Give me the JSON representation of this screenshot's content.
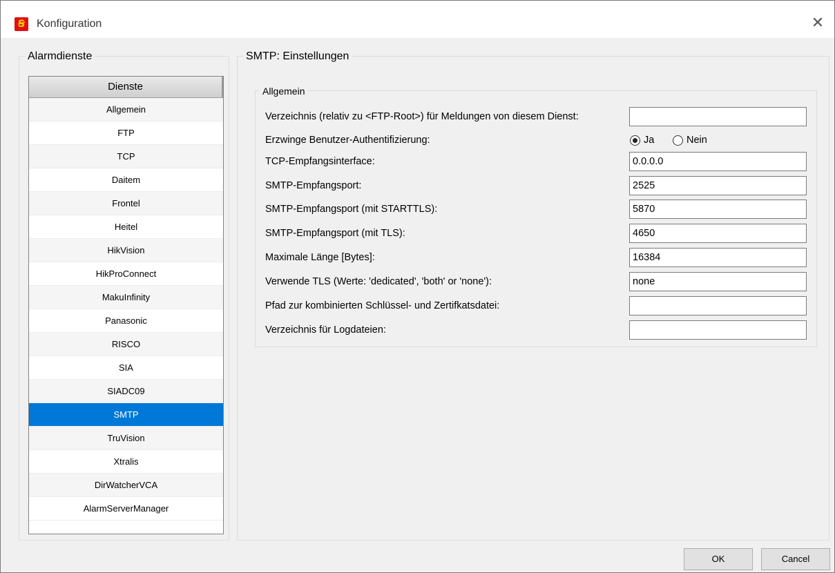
{
  "window": {
    "title": "Konfiguration",
    "close_glyph": "✕"
  },
  "left_panel": {
    "title": "Alarmdienste",
    "list_header": "Dienste",
    "items": [
      {
        "label": "Allgemein"
      },
      {
        "label": "FTP"
      },
      {
        "label": "TCP"
      },
      {
        "label": "Daitem"
      },
      {
        "label": "Frontel"
      },
      {
        "label": "Heitel"
      },
      {
        "label": "HikVision"
      },
      {
        "label": "HikProConnect"
      },
      {
        "label": "MakuInfinity"
      },
      {
        "label": "Panasonic"
      },
      {
        "label": "RISCO"
      },
      {
        "label": "SIA"
      },
      {
        "label": "SIADC09"
      },
      {
        "label": "SMTP",
        "selected": true
      },
      {
        "label": "TruVision"
      },
      {
        "label": "Xtralis"
      },
      {
        "label": "DirWatcherVCA"
      },
      {
        "label": "AlarmServerManager"
      }
    ]
  },
  "right_panel": {
    "title": "SMTP: Einstellungen",
    "group_title": "Allgemein",
    "fields": {
      "ftp_dir": {
        "label": "Verzeichnis (relativ zu <FTP-Root>) für Meldungen von diesem Dienst:",
        "value": ""
      },
      "auth": {
        "label": "Erzwinge Benutzer-Authentifizierung:",
        "option_yes": "Ja",
        "option_no": "Nein",
        "selected": "Ja"
      },
      "tcp_iface": {
        "label": "TCP-Empfangsinterface:",
        "value": "0.0.0.0"
      },
      "smtp_port": {
        "label": "SMTP-Empfangsport:",
        "value": "2525"
      },
      "smtp_port_starttls": {
        "label": "SMTP-Empfangsport (mit STARTTLS):",
        "value": "5870"
      },
      "smtp_port_tls": {
        "label": "SMTP-Empfangsport (mit TLS):",
        "value": "4650"
      },
      "max_len": {
        "label": "Maximale Länge [Bytes]:",
        "value": "16384"
      },
      "use_tls": {
        "label": "Verwende TLS (Werte: 'dedicated', 'both' or 'none'):",
        "value": "none"
      },
      "cert_path": {
        "label": "Pfad zur kombinierten Schlüssel- und Zertifkatsdatei:",
        "value": ""
      },
      "log_dir": {
        "label": "Verzeichnis für Logdateien:",
        "value": ""
      }
    }
  },
  "buttons": {
    "ok": "OK",
    "cancel": "Cancel"
  },
  "colors": {
    "selection": "#0078d7",
    "app_icon": "#e01010"
  }
}
